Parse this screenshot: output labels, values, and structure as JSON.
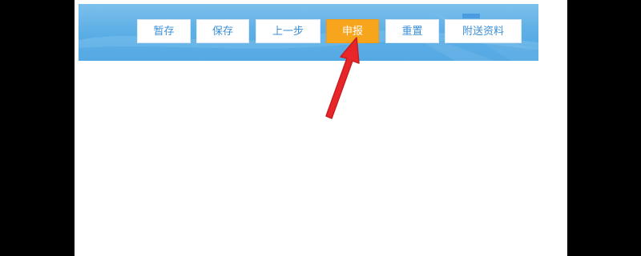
{
  "toolbar": {
    "buttons": [
      {
        "label": "暂存"
      },
      {
        "label": "保存"
      },
      {
        "label": "上一步"
      },
      {
        "label": "申报"
      },
      {
        "label": "重置"
      },
      {
        "label": "附送资料"
      }
    ]
  },
  "colors": {
    "banner": "#5fb0e6",
    "button_text": "#3b8fd6",
    "primary_button": "#f7a51d",
    "arrow": "#e8262a"
  },
  "annotation": {
    "icon": "red-arrow-icon"
  }
}
